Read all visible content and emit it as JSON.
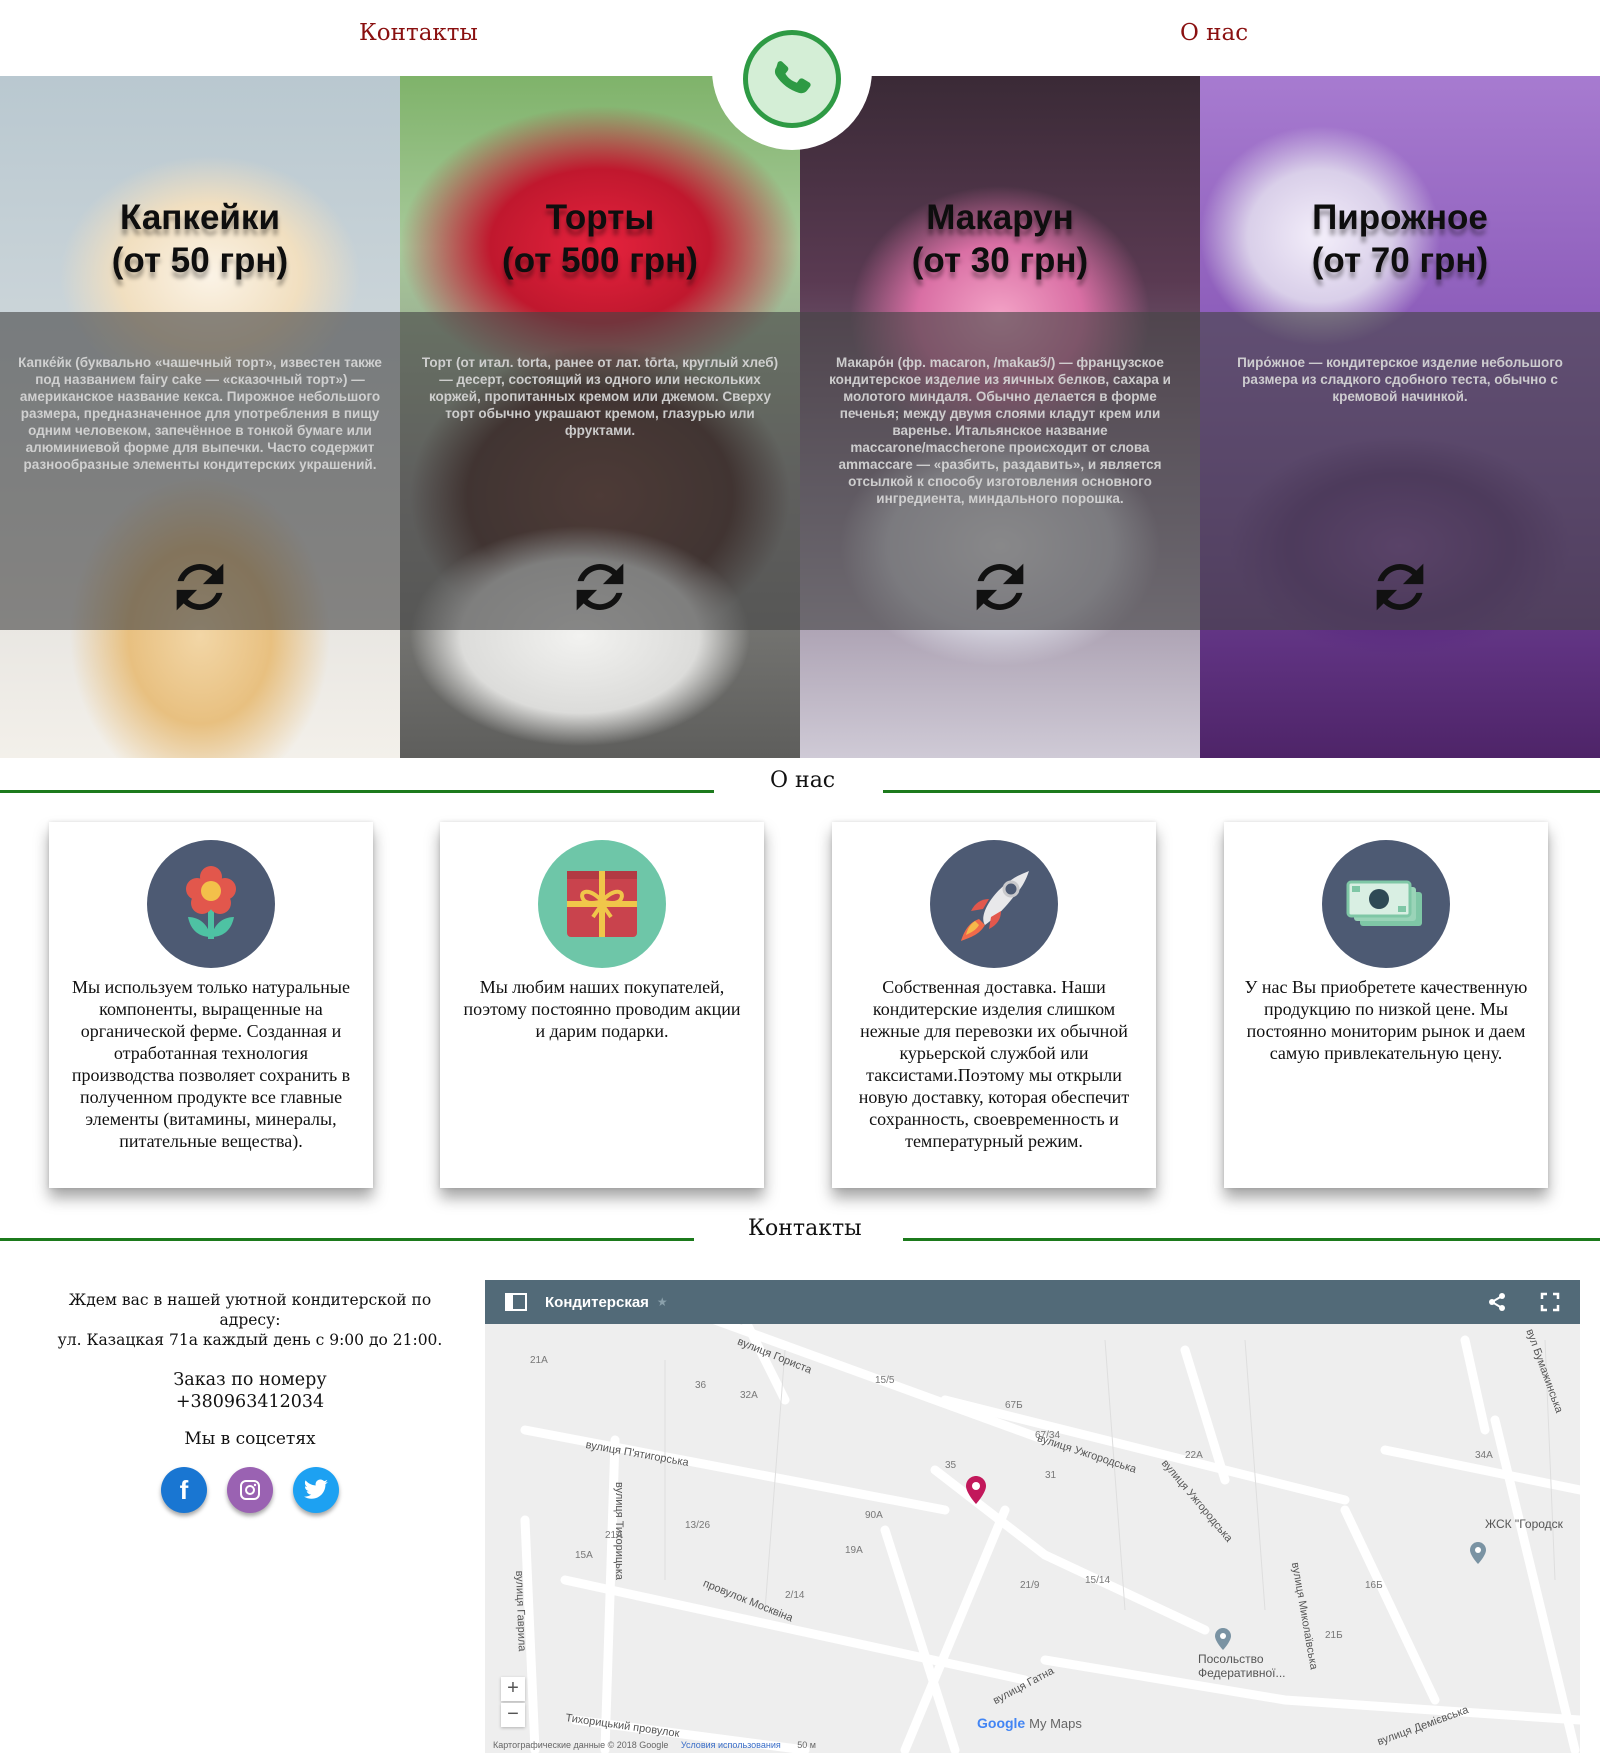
{
  "header": {
    "nav_contacts": "Контакты",
    "nav_about": "О нас",
    "phone_icon": "phone-icon"
  },
  "products": [
    {
      "title": "Капкейки\n(от 50 грн)",
      "description": "Капке́йк (буквально «чашечный торт», известен также под названием fairy cake — «сказочный торт») — американское название кекса. Пирожное небольшого размера, предназначенное для употребления в пищу одним человеком, запечённое в тонкой бумаге или алюминиевой форме для выпечки. Часто содержит разнообразные элементы кондитерских украшений."
    },
    {
      "title": "Торты\n(от 500 грн)",
      "description": "Торт (от итал. torta, ранее от лат. tōrta, круглый хлеб) — десерт, состоящий из одного или нескольких коржей, пропитанных кремом или джемом. Сверху торт обычно украшают кремом, глазурью или фруктами."
    },
    {
      "title": "Макарун\n(от 30 грн)",
      "description": "Макаро́н (фр. macaron, /makaʁɔ̃/) — французское кондитерское изделие из яичных белков, сахара и молотого миндаля. Обычно делается в форме печенья; между двумя слоями кладут крем или варенье. Итальянское название maccarone/maccherone происходит от слова ammaccare — «разбить, раздавить», и является отсылкой к способу изготовления основного ингредиента, миндального порошка."
    },
    {
      "title": "Пирожное\n(от 70 грн)",
      "description": "Пиро́жное — кондитерское изделие небольшого размера из сладкого сдобного теста, обычно с кремовой начинкой."
    }
  ],
  "about": {
    "title": "О нас",
    "features": [
      {
        "icon": "flower-icon",
        "text": "Мы используем только натуральные компоненты, выращенные на органической ферме. Созданная и отработанная технология производства позволяет сохранить в полученном продукте все главные элементы (витамины, минералы, питательные вещества)."
      },
      {
        "icon": "gift-icon",
        "text": "Мы любим наших покупателей, поэтому постоянно проводим акции и дарим подарки."
      },
      {
        "icon": "rocket-icon",
        "text": "Собственная доставка. Наши кондитерские изделия слишком нежные для перевозки их обычной курьерской службой или таксистами.Поэтому мы открыли новую доставку, которая обеспечит сохранность, своевременность и температурный режим."
      },
      {
        "icon": "money-icon",
        "text": "У нас Вы приобретете качественную продукцию по низкой цене. Мы постоянно мониторим рынок и даем самую привлекательную цену."
      }
    ]
  },
  "contacts": {
    "title": "Контакты",
    "address_line1": "Ждем вас в нашей уютной кондитерской по адресу:",
    "address_line2": "ул. Казацкая 71а каждый день с 9:00 до 21:00.",
    "order_line1": "Заказ по номеру",
    "order_line2": "+380963412034",
    "social_label": "Мы в соцсетях",
    "socials": [
      "facebook-icon",
      "instagram-icon",
      "twitter-icon"
    ]
  },
  "map": {
    "title": "Кондитерская",
    "streets": [
      "вулиця Гориста",
      "вулиця П'ятигорська",
      "вулиця Тихорицька",
      "вулиця Ужгородська",
      "провулок Москвіна",
      "вулиця Гаврила",
      "Тихорицький провулок",
      "вулиця Гатна",
      "вулиця Миколаївська",
      "вулиця Демієвська",
      "вул Бумажинська"
    ],
    "poi_1": "ЖСК \"Городск",
    "poi_2_line1": "Посольство",
    "poi_2_line2": "Федеративної...",
    "zoom_in": "+",
    "zoom_out": "−",
    "brand_google": "Google",
    "brand_mymaps": "My Maps",
    "attribution": "Картографические данные © 2018 Google",
    "terms": "Условия использования",
    "scale": "50 м"
  },
  "colors": {
    "nav_text": "#8a1010",
    "section_line": "#1c7a1c",
    "phone_green": "#2e9a44",
    "feature_icon_bg": "#4d5a73",
    "map_bar": "#526a78"
  }
}
